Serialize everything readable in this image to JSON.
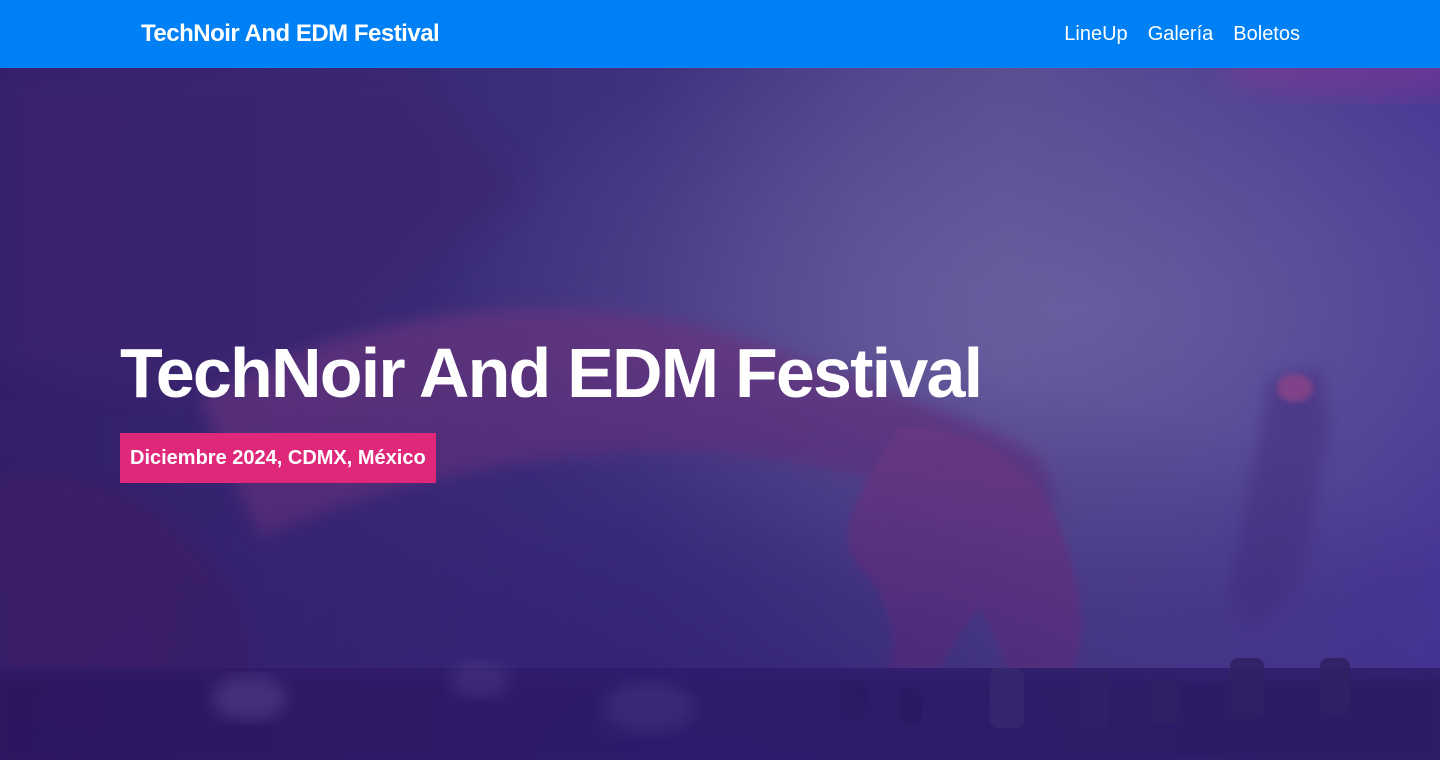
{
  "navbar": {
    "brand": "TechNoir And EDM Festival",
    "links": [
      {
        "label": "LineUp"
      },
      {
        "label": "Galería"
      },
      {
        "label": "Boletos"
      }
    ],
    "background_color": "#0080f5"
  },
  "hero": {
    "title": "TechNoir And EDM Festival",
    "subtitle": "Diciembre 2024, CDMX, México",
    "badge_color": "#df2879",
    "background_icon": "dj-mixer-photo"
  }
}
